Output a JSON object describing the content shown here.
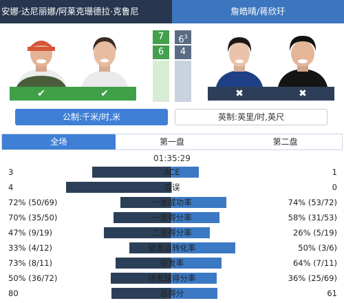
{
  "header": {
    "team_left": "安娜·达尼丽娜/阿莱克珊德拉·克鲁尼",
    "team_right": "詹皓晴/蒋欣玗"
  },
  "colors": {
    "header_left": "#28374f",
    "header_right": "#3d76be",
    "win_green": "#3fa048",
    "lose_navy": "#2d3f58",
    "bar_left": "#2c3f58",
    "bar_right": "#3c79c4",
    "accent_blue": "#3f7fd6"
  },
  "players": [
    {
      "status_icon": "check-icon",
      "result": "win"
    },
    {
      "status_icon": "check-icon",
      "result": "win"
    },
    {
      "status_icon": "x-icon",
      "result": "lose"
    },
    {
      "status_icon": "x-icon",
      "result": "lose"
    }
  ],
  "score": {
    "set1_left": "7",
    "set2_left": "6",
    "set2_left_tb": "3",
    "set1_right": "6",
    "set2_right": "4"
  },
  "units": {
    "metric": "公制:千米/时,米",
    "imperial": "英制:英里/时,英尺"
  },
  "tabs": [
    "全场",
    "第一盘",
    "第二盘"
  ],
  "duration": "01:35:29",
  "stats": [
    {
      "label": "ACE",
      "left": "3",
      "right": "1",
      "left_frac": 0.75,
      "right_frac": 0.25
    },
    {
      "label": "双误",
      "left": "4",
      "right": "0",
      "left_frac": 1.0,
      "right_frac": 0.0
    },
    {
      "label": "一发成功率",
      "left": "72% (50/69)",
      "right": "74% (53/72)",
      "left_frac": 0.49,
      "right_frac": 0.51
    },
    {
      "label": "一发得分率",
      "left": "70% (35/50)",
      "right": "58% (31/53)",
      "left_frac": 0.55,
      "right_frac": 0.45
    },
    {
      "label": "二发得分率",
      "left": "47% (9/19)",
      "right": "26% (5/19)",
      "left_frac": 0.64,
      "right_frac": 0.36
    },
    {
      "label": "破发点转化率",
      "left": "33% (4/12)",
      "right": "50% (3/6)",
      "left_frac": 0.4,
      "right_frac": 0.6
    },
    {
      "label": "保发率",
      "left": "73% (8/11)",
      "right": "64% (7/11)",
      "left_frac": 0.53,
      "right_frac": 0.47
    },
    {
      "label": "接发球得分率",
      "left": "50% (36/72)",
      "right": "36% (25/69)",
      "left_frac": 0.58,
      "right_frac": 0.42
    },
    {
      "label": "总得分",
      "left": "80",
      "right": "61",
      "left_frac": 0.57,
      "right_frac": 0.43
    }
  ]
}
